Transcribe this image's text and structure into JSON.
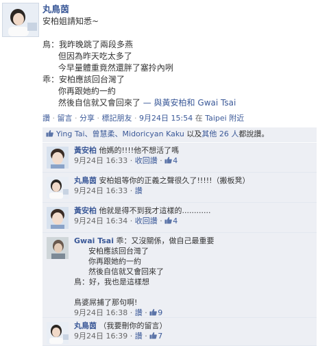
{
  "post": {
    "author": "丸鳥茵",
    "lines": [
      "安柏姐請知悉~",
      "",
      "鳥：我昨晚跳了兩段多燕",
      "      但因為昨天吃太多了",
      "      今早量體重竟然還胖了塞拎內咧",
      "乖：安柏應該回台灣了",
      "      你再跟她約一約",
      "      然後自信就又會回來了"
    ],
    "tag_prefix": " — 與",
    "tagged_1": "黃安柏",
    "tag_and": "和",
    "tagged_2": "Gwai Tsai",
    "actions": {
      "like": "讚",
      "comment": "留言",
      "share": "分享",
      "tag_friends": "標記朋友"
    },
    "timestamp": "9月24日 15:54",
    "location_prefix": "在",
    "location": "Taipei 附近"
  },
  "likes_bar": {
    "names": "Ying Tai、曾慧柔、Midoricyan Kaku",
    "middle": "以及",
    "others": "其他 26 人",
    "suffix": "都說讚。"
  },
  "comments": [
    {
      "author": "黃安柏",
      "text": "他媽的!!!!他不想活了嗎",
      "time": "9月24日 16:33",
      "action": "收回讚",
      "likes": "4"
    },
    {
      "author": "丸鳥茵",
      "text": "安柏姐等你的正義之聲很久了!!!!!（搬板凳）",
      "time": "9月24日 16:33",
      "action": "讚",
      "likes": ""
    },
    {
      "author": "黃安柏",
      "text": "他就是得不到我才這樣的............",
      "time": "9月24日 16:34",
      "action": "收回讚",
      "likes": "4"
    },
    {
      "author": "Gwai Tsai",
      "first_line": "乖：又沒關係，做自己最重要",
      "lines": [
        "      安柏應該回台灣了",
        "      你再跟她約一約",
        "      然後自信就又會回來了",
        "鳥：好，我也是這樣想",
        "",
        "鳥婆屌捕了那句啊!"
      ],
      "time": "9月24日 16:38",
      "action": "讚",
      "likes": "9"
    },
    {
      "author": "丸鳥茵",
      "text": "（我要刪你的留言）",
      "time": "9月24日 16:39",
      "action": "讚",
      "likes": "7"
    }
  ]
}
